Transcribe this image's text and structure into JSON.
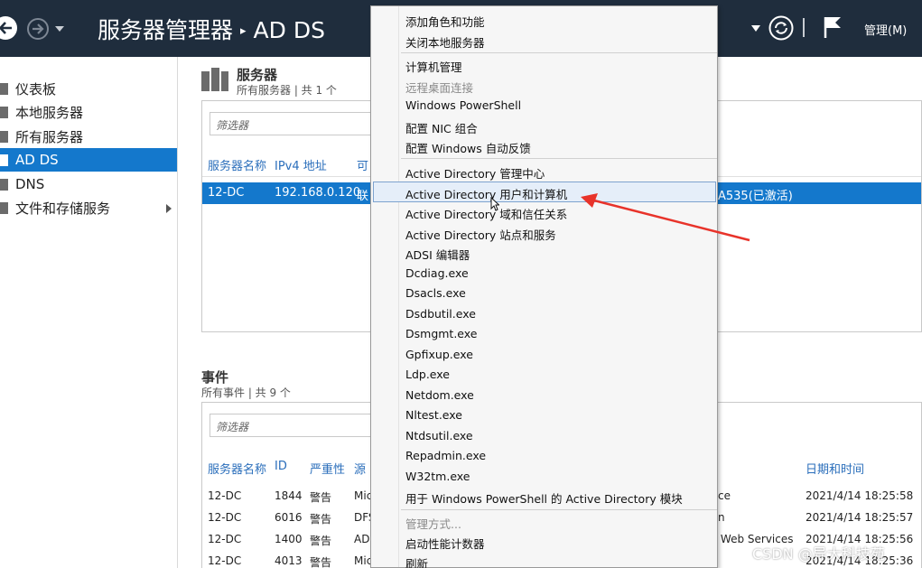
{
  "titlebar": {
    "crumb_root": "服务器管理器",
    "crumb_sep": "▸",
    "crumb_current": "AD DS",
    "manage_label": "管理(M)"
  },
  "sidebar": {
    "items": [
      {
        "label": "仪表板"
      },
      {
        "label": "本地服务器"
      },
      {
        "label": "所有服务器"
      },
      {
        "label": "AD DS"
      },
      {
        "label": "DNS"
      },
      {
        "label": "文件和存储服务"
      }
    ]
  },
  "servers": {
    "title": "服务器",
    "subtitle": "所有服务器 | 共 1 个",
    "filter_placeholder": "筛选器",
    "columns": [
      "服务器名称",
      "IPv4 地址",
      "可"
    ],
    "row": {
      "name": "12-DC",
      "ip": "192.168.0.120",
      "status": "联",
      "right": "A535(已激活)"
    }
  },
  "events": {
    "title": "事件",
    "subtitle": "所有事件 | 共 9 个",
    "filter_placeholder": "筛选器",
    "columns": [
      "服务器名称",
      "ID",
      "严重性",
      "源",
      "日期和时间"
    ],
    "rows": [
      {
        "server": "12-DC",
        "id": "1844",
        "severity": "警告",
        "source": "Mic",
        "tail": "ce",
        "date": "2021/4/14 18:25:58"
      },
      {
        "server": "12-DC",
        "id": "6016",
        "severity": "警告",
        "source": "DFS",
        "tail": "n",
        "date": "2021/4/14 18:25:57"
      },
      {
        "server": "12-DC",
        "id": "1400",
        "severity": "警告",
        "source": "ADI",
        "tail": "y Web Services",
        "date": "2021/4/14 18:25:56"
      },
      {
        "server": "12-DC",
        "id": "4013",
        "severity": "警告",
        "source": "Mic",
        "tail": "",
        "date": "2021/4/14 18:25:36"
      }
    ]
  },
  "context_menu": {
    "items": [
      {
        "label": "添加角色和功能"
      },
      {
        "label": "关闭本地服务器"
      },
      {
        "label": "计算机管理"
      },
      {
        "label": "远程桌面连接",
        "disabled": true
      },
      {
        "label": "Windows PowerShell"
      },
      {
        "label": "配置 NIC 组合"
      },
      {
        "label": "配置 Windows 自动反馈"
      },
      {
        "label": "Active Directory 管理中心"
      },
      {
        "label": "Active Directory 用户和计算机",
        "highlighted": true
      },
      {
        "label": "Active Directory 域和信任关系"
      },
      {
        "label": "Active Directory 站点和服务"
      },
      {
        "label": "ADSI 编辑器"
      },
      {
        "label": "Dcdiag.exe"
      },
      {
        "label": "Dsacls.exe"
      },
      {
        "label": "Dsdbutil.exe"
      },
      {
        "label": "Dsmgmt.exe"
      },
      {
        "label": "Gpfixup.exe"
      },
      {
        "label": "Ldp.exe"
      },
      {
        "label": "Netdom.exe"
      },
      {
        "label": "Nltest.exe"
      },
      {
        "label": "Ntdsutil.exe"
      },
      {
        "label": "Repadmin.exe"
      },
      {
        "label": "W32tm.exe"
      },
      {
        "label": "用于 Windows PowerShell 的 Active Directory 模块"
      },
      {
        "label": "管理方式...",
        "disabled": true
      },
      {
        "label": "启动性能计数器"
      },
      {
        "label": "刷新"
      }
    ]
  },
  "watermark": "CSDN @异大科技苑",
  "colors": {
    "titlebar": "#1f2d3d",
    "selection": "#1478cc",
    "link_header": "#2a6ebb",
    "annotation_arrow": "#e8332a"
  }
}
